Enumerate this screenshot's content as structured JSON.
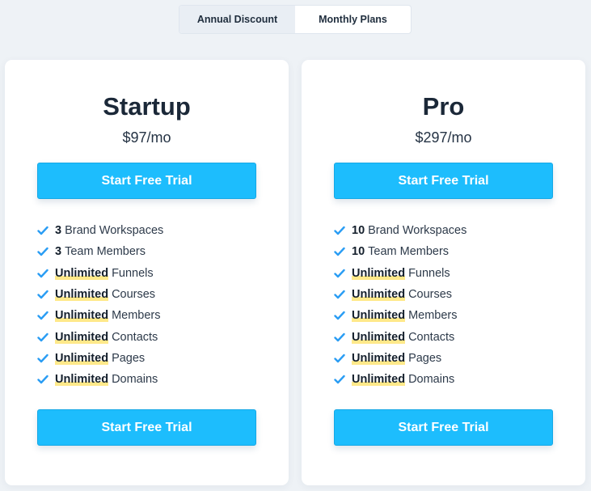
{
  "toggle": {
    "options": [
      {
        "label": "Annual Discount",
        "active": true
      },
      {
        "label": "Monthly Plans",
        "active": false
      }
    ]
  },
  "plans": [
    {
      "name": "Startup",
      "price": "$97/mo",
      "cta_top": "Start Free Trial",
      "cta_bottom": "Start Free Trial",
      "features": [
        {
          "strong": "3",
          "text": "Brand Workspaces",
          "highlight": false
        },
        {
          "strong": "3",
          "text": "Team Members",
          "highlight": false
        },
        {
          "strong": "Unlimited",
          "text": "Funnels",
          "highlight": true
        },
        {
          "strong": "Unlimited",
          "text": "Courses",
          "highlight": true
        },
        {
          "strong": "Unlimited",
          "text": "Members",
          "highlight": true
        },
        {
          "strong": "Unlimited",
          "text": "Contacts",
          "highlight": true
        },
        {
          "strong": "Unlimited",
          "text": "Pages",
          "highlight": true
        },
        {
          "strong": "Unlimited",
          "text": "Domains",
          "highlight": true
        }
      ]
    },
    {
      "name": "Pro",
      "price": "$297/mo",
      "cta_top": "Start Free Trial",
      "cta_bottom": "Start Free Trial",
      "features": [
        {
          "strong": "10",
          "text": "Brand Workspaces",
          "highlight": false
        },
        {
          "strong": "10",
          "text": "Team Members",
          "highlight": false
        },
        {
          "strong": "Unlimited",
          "text": "Funnels",
          "highlight": true
        },
        {
          "strong": "Unlimited",
          "text": "Courses",
          "highlight": true
        },
        {
          "strong": "Unlimited",
          "text": "Members",
          "highlight": true
        },
        {
          "strong": "Unlimited",
          "text": "Contacts",
          "highlight": true
        },
        {
          "strong": "Unlimited",
          "text": "Pages",
          "highlight": true
        },
        {
          "strong": "Unlimited",
          "text": "Domains",
          "highlight": true
        }
      ]
    }
  ],
  "colors": {
    "accent": "#1dbdfd",
    "check": "#2a9df4",
    "highlight": "#ffe98a"
  }
}
